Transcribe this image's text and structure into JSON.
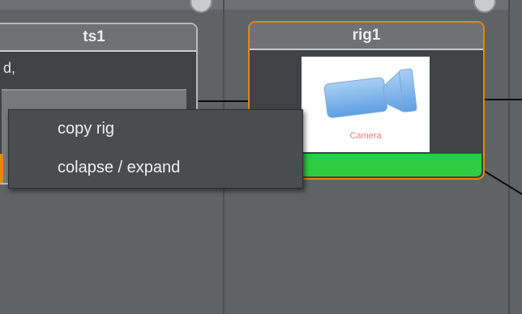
{
  "nodes": {
    "ts1": {
      "title": "ts1",
      "body_text": "d,"
    },
    "rig1": {
      "title": "rig1",
      "thumbnail_icon": "camera-icon",
      "thumbnail_caption": "Camera",
      "status_color": "#2ecc40",
      "border_color": "#e08a00"
    }
  },
  "context_menu": {
    "items": [
      {
        "label": "copy rig"
      },
      {
        "label": "colapse / expand"
      }
    ]
  },
  "colors": {
    "background": "#5c5f62",
    "node_body": "#404346",
    "node_header": "#6f7275",
    "selection_orange": "#e08a00",
    "status_green": "#2ecc40",
    "wire": "#0b0b0b"
  }
}
